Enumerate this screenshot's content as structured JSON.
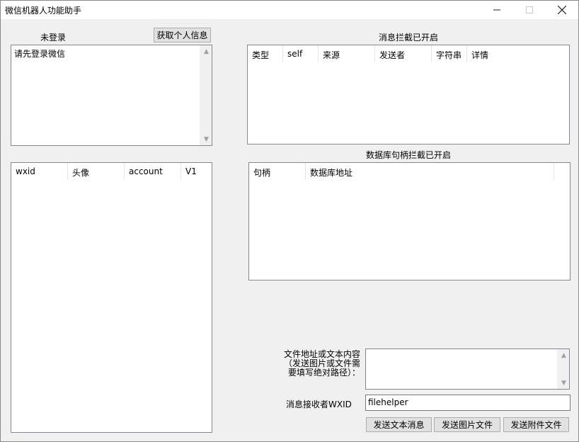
{
  "window": {
    "title": "微信机器人功能助手"
  },
  "account_panel": {
    "status_label": "未登录",
    "fetch_info_button": "获取个人信息",
    "info_text": "请先登录微信"
  },
  "contacts_table": {
    "columns": [
      "wxid",
      "头像",
      "account",
      "V1"
    ]
  },
  "message_intercept": {
    "title": "消息拦截已开启",
    "columns": [
      "类型",
      "self",
      "来源",
      "发送者",
      "字符串",
      "详情"
    ]
  },
  "db_intercept": {
    "title": "数据库句柄拦截已开启",
    "columns": [
      "句柄",
      "数据库地址"
    ]
  },
  "send_panel": {
    "content_label_line1": "文件地址或文本内容",
    "content_label_line2": "（发送图片或文件需",
    "content_label_line3": "要填写绝对路径）：",
    "content_value": "",
    "receiver_label": "消息接收者WXID",
    "receiver_value": "filehelper",
    "send_text_button": "发送文本消息",
    "send_image_button": "发送图片文件",
    "send_file_button": "发送附件文件"
  }
}
